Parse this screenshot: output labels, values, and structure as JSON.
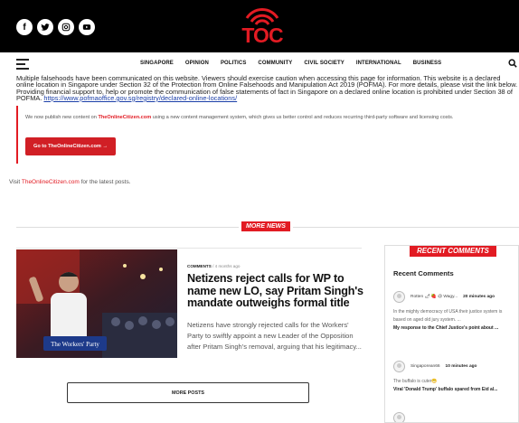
{
  "header": {
    "social": [
      {
        "name": "facebook-icon",
        "glyph": "f"
      },
      {
        "name": "twitter-icon",
        "glyph": "🐦"
      },
      {
        "name": "instagram-icon",
        "glyph": "◎"
      },
      {
        "name": "youtube-icon",
        "glyph": "▶"
      }
    ],
    "logo_text": "TOC",
    "brand_color": "#e21b23"
  },
  "nav": {
    "items": [
      "SINGAPORE",
      "OPINION",
      "POLITICS",
      "COMMUNITY",
      "CIVIL SOCIETY",
      "INTERNATIONAL",
      "BUSINESS"
    ]
  },
  "notice": {
    "text": "Multiple falsehoods have been communicated on this website. Viewers should exercise caution when accessing this page for information. This website is a declared online location in Singapore under Section 32 of the Protection from Online Falsehoods and Manipulation Act 2019 (POFMA). For more details, please visit the link below. Providing financial support to, help or promote the communication of false statements of fact in Singapore on a declared online location is prohibited under Section 38 of POFMA.",
    "link": "https://www.pofmaoffice.gov.sg/registry/declared-online-locations/"
  },
  "infobox": {
    "pre": "We now publish new content on ",
    "brand": "TheOnlineCitizen.com",
    "post": " using a new content management system, which gives us better control and reduces recurring third-party software and licensing costs.",
    "button": "Go to TheOnlineCitizen.com →"
  },
  "visit": {
    "pre": "Visit ",
    "link": "TheOnlineCitizen.com",
    "post": " for the latest posts."
  },
  "more_news_label": "MORE NEWS",
  "article": {
    "category": "COMMENTS",
    "time": "4 months ago",
    "headline": "Netizens reject calls for WP to name new LO, say Pritam Singh's mandate outweighs formal title",
    "excerpt": "Netizens have strongly rejected calls for the Workers' Party to swiftly appoint a new Leader of the Opposition after Pritam Singh's removal, arguing that his legitimacy...",
    "image_caption": "The Workers' Party"
  },
  "more_posts_label": "MORE POSTS",
  "sidebar": {
    "title": "RECENT COMMENTS",
    "subtitle": "Recent Comments",
    "comments": [
      {
        "author": "Rotten 🌶 🍓 @ Wagy...",
        "time": "20 minutes ago",
        "body": "In the mighty democracy of USA their justice system is based on aged old jury system. ...",
        "post": "My response to the Chief Justice's point about ..."
      },
      {
        "author": "Singaporean66",
        "time": "10 minutes ago",
        "body": "The buffalo is cuter😁",
        "post": "Viral 'Donald Trump' buffalo spared from Eid al..."
      }
    ]
  }
}
